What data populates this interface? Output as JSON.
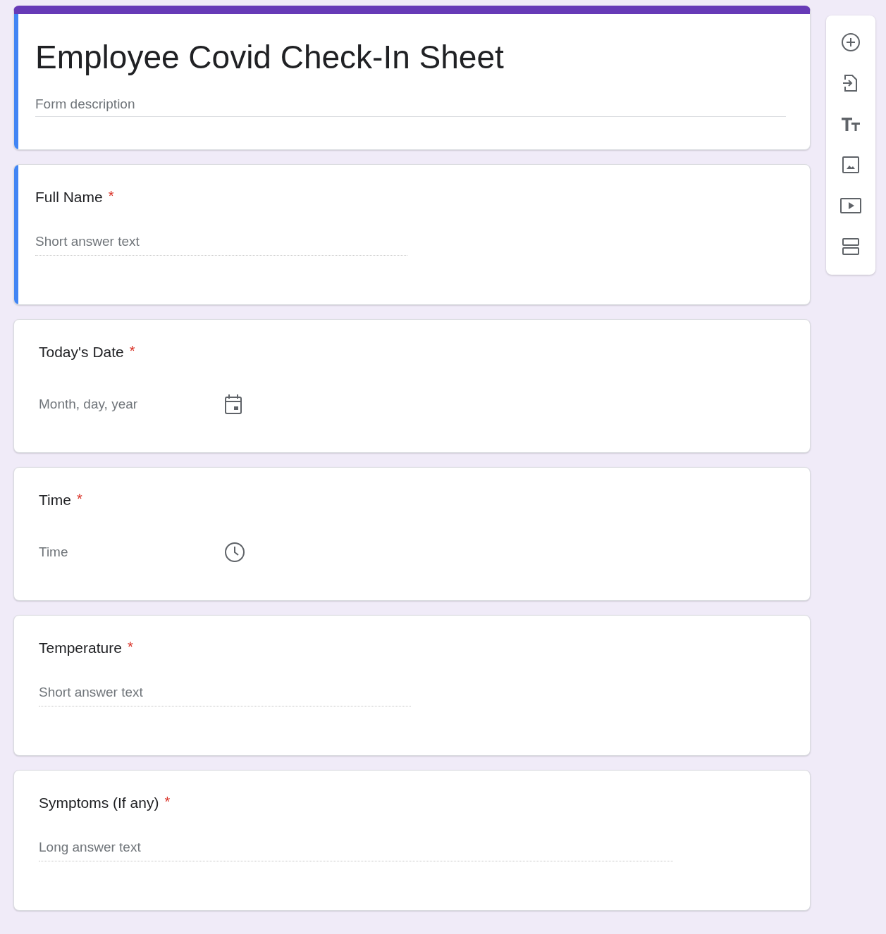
{
  "form": {
    "title": "Employee Covid Check-In Sheet",
    "description_placeholder": "Form description",
    "focused": true
  },
  "questions": [
    {
      "kind": "short",
      "title": "Full Name",
      "required": true,
      "required_mark": "*",
      "placeholder": "Short answer text",
      "focused": true
    },
    {
      "kind": "date",
      "title": "Today's Date",
      "required": true,
      "required_mark": "*",
      "placeholder": "Month, day, year",
      "focused": false
    },
    {
      "kind": "time",
      "title": "Time",
      "required": true,
      "required_mark": "*",
      "placeholder": "Time",
      "focused": false
    },
    {
      "kind": "short",
      "title": "Temperature",
      "required": true,
      "required_mark": "*",
      "placeholder": "Short answer text",
      "focused": false
    },
    {
      "kind": "paragraph",
      "title": "Symptoms (If any)",
      "required": true,
      "required_mark": "*",
      "placeholder": "Long answer text",
      "focused": false
    }
  ],
  "toolbar": [
    {
      "kind": "add"
    },
    {
      "kind": "import"
    },
    {
      "kind": "title"
    },
    {
      "kind": "image"
    },
    {
      "kind": "video"
    },
    {
      "kind": "section"
    }
  ]
}
